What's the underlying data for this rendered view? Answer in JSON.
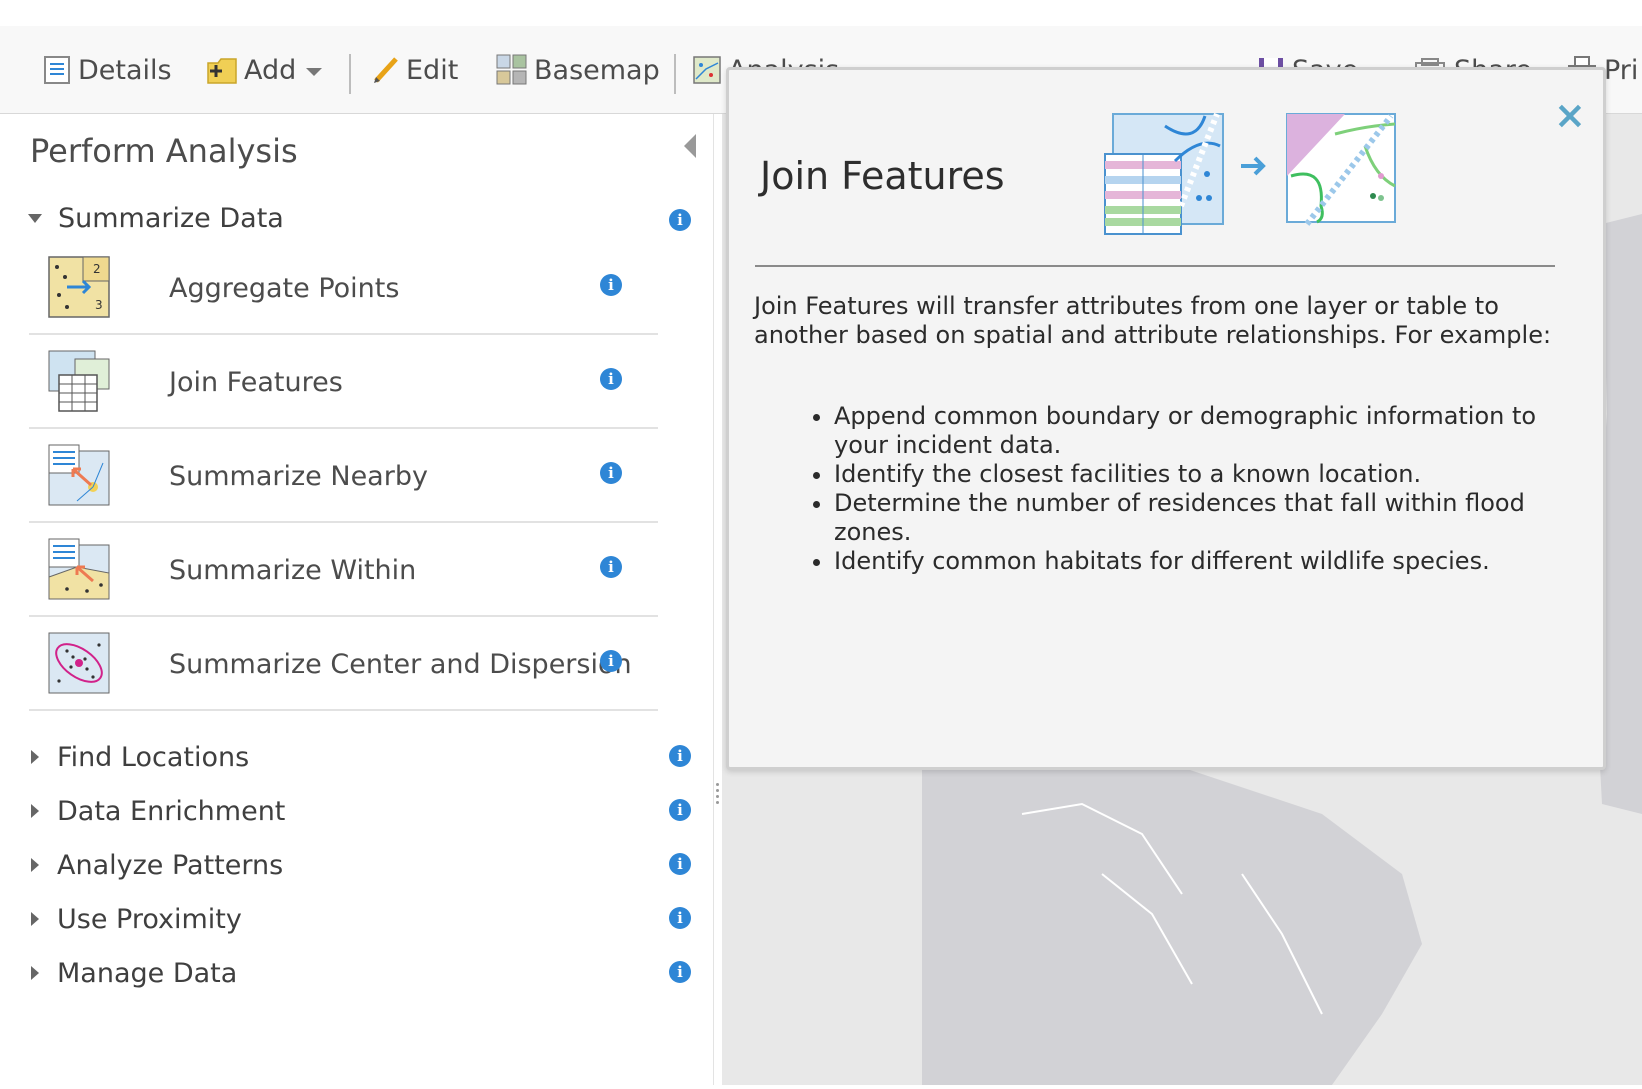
{
  "toolbar": {
    "details": "Details",
    "add": "Add",
    "edit": "Edit",
    "basemap": "Basemap",
    "analysis": "Analysis",
    "save": "Save",
    "share": "Share",
    "print": "Pri"
  },
  "panel": {
    "title": "Perform Analysis",
    "expanded_category": "Summarize Data",
    "tools": [
      {
        "label": "Aggregate Points",
        "icon": "aggregate-points-icon"
      },
      {
        "label": "Join Features",
        "icon": "join-features-icon"
      },
      {
        "label": "Summarize Nearby",
        "icon": "summarize-nearby-icon"
      },
      {
        "label": "Summarize Within",
        "icon": "summarize-within-icon"
      },
      {
        "label": "Summarize Center and Dispersion",
        "icon": "center-dispersion-icon"
      }
    ],
    "collapsed_categories": [
      "Find Locations",
      "Data Enrichment",
      "Analyze Patterns",
      "Use Proximity",
      "Manage Data"
    ]
  },
  "popup": {
    "title": "Join Features",
    "description": "Join Features will transfer attributes from one layer or table to another based on spatial and attribute relationships. For example:",
    "bullets": [
      "Append common boundary or demographic information to your incident data.",
      "Identify the closest facilities to a known location.",
      "Determine the number of residences that fall within flood zones.",
      "Identify common habitats for different wildlife species."
    ],
    "close": "×"
  },
  "colors": {
    "info_blue": "#2e86d6",
    "close_teal": "#5aa5c7",
    "map_bg": "#e8e8e8",
    "land": "#d2d2d6"
  }
}
